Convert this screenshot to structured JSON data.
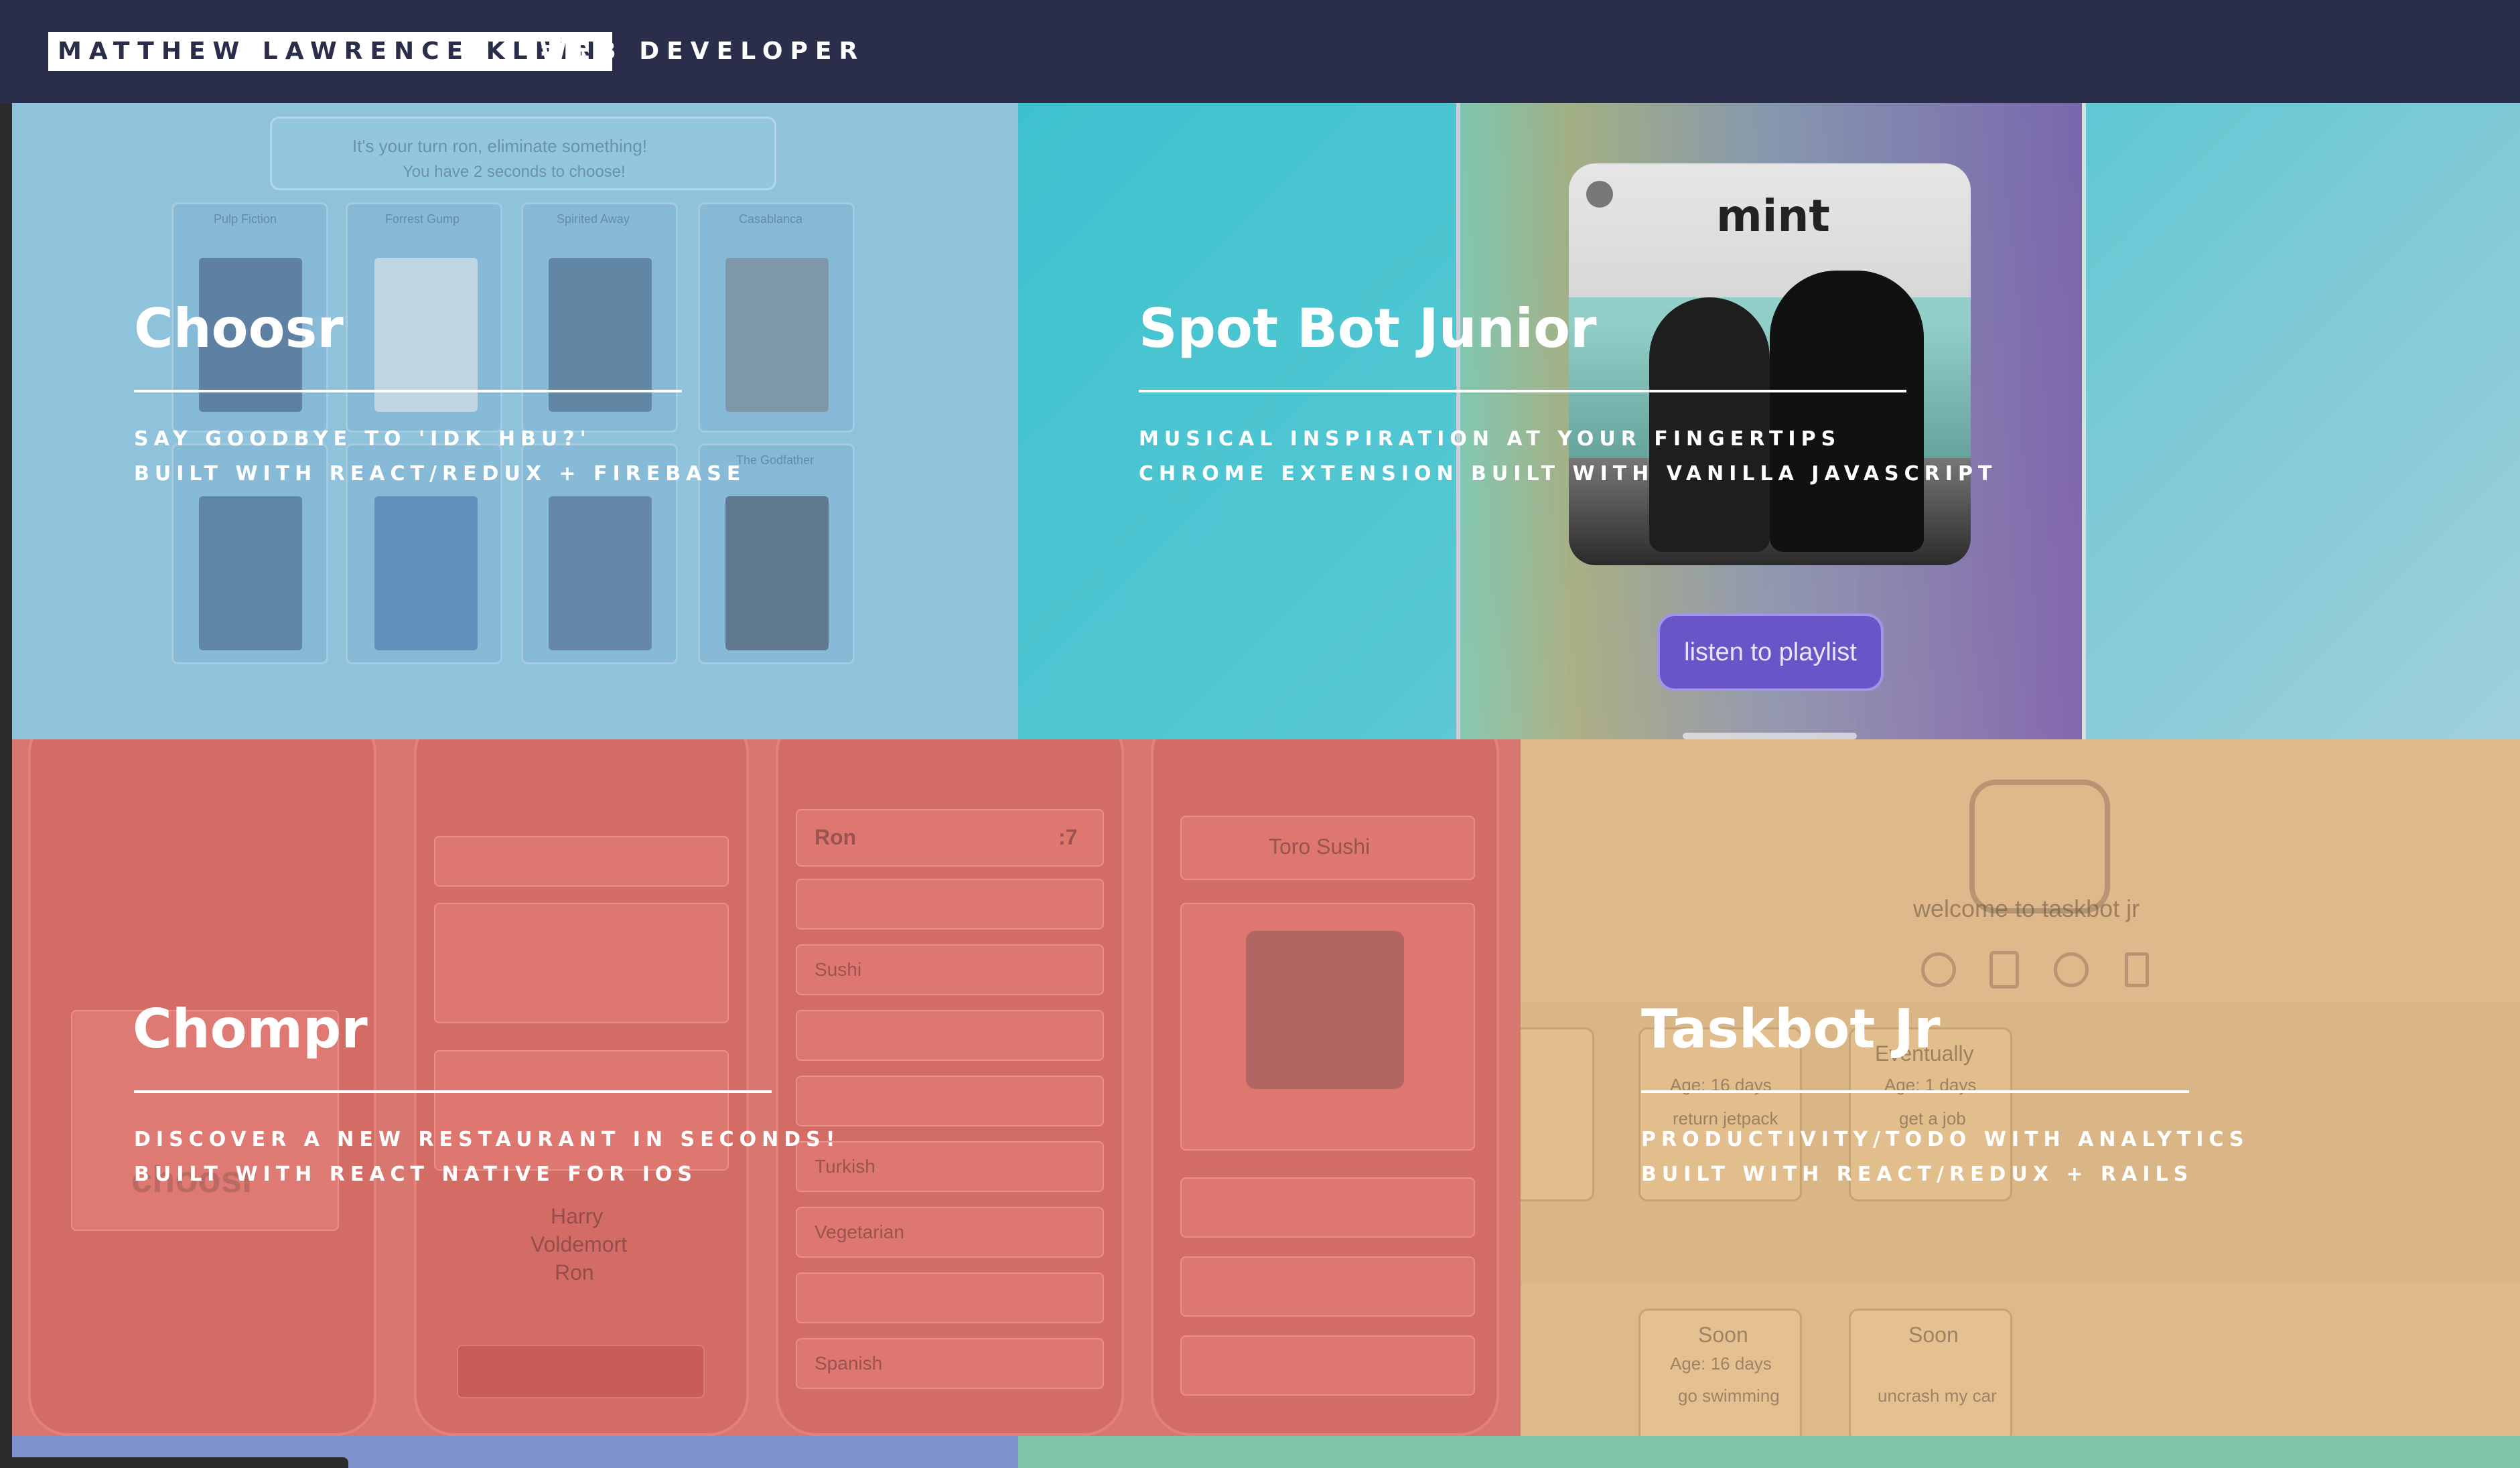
{
  "header": {
    "name": "MATTHEW LAWRENCE KLEIN",
    "role": "WEB DEVELOPER"
  },
  "projects": [
    {
      "title": "Choosr",
      "line1": "SAY GOODBYE TO 'IDK HBU?'",
      "line2": "BUILT WITH REACT/REDUX + FIREBASE"
    },
    {
      "title": "Spot Bot Junior",
      "line1": "MUSICAL INSPIRATION AT YOUR FINGERTIPS",
      "line2": "CHROME EXTENSION BUILT WITH VANILLA JAVASCRIPT"
    },
    {
      "title": "Chompr",
      "line1": "DISCOVER A NEW RESTAURANT IN SECONDS!",
      "line2": "BUILT WITH REACT NATIVE FOR IOS"
    },
    {
      "title": "Taskbot Jr",
      "line1": "PRODUCTIVITY/TODO WITH ANALYTICS",
      "line2": "BUILT WITH REACT/REDUX + RAILS"
    }
  ],
  "previews": {
    "choosr_prompt1": "It's your turn ron, eliminate something!",
    "choosr_prompt2": "You have 2 seconds to choose!",
    "choosr_movies": [
      "Pulp Fiction",
      "Forrest Gump",
      "Spirited Away",
      "Casablanca",
      "The Godfather"
    ],
    "spotbot_album": "mint",
    "spotbot_button": "listen to playlist",
    "chompr_restaurant": "Toro Sushi",
    "chompr_name": "Ron",
    "chompr_count": ":7",
    "chompr_options": [
      "Sushi",
      "Turkish",
      "Vegetarian",
      "Spanish"
    ],
    "chompr_players": [
      "Harry",
      "Voldemort",
      "Ron"
    ],
    "chompr_logo": "choosr",
    "taskbot_welcome": "welcome to taskbot jr",
    "taskbot_cols": [
      "Eventually",
      "Soon",
      "Soon"
    ],
    "taskbot_ages": [
      "Age: 16 days",
      "Age: 1 days",
      "Age: 16 days"
    ],
    "taskbot_tasks": [
      "return jetpack",
      "get a job",
      "go swimming",
      "uncrash my car"
    ]
  },
  "colors": {
    "header_bg": "#2a2e4a",
    "choosr": "#8fc3db",
    "spotbot": "#47c3d2",
    "chompr": "#d87770",
    "taskbot": "#dfb88c"
  }
}
